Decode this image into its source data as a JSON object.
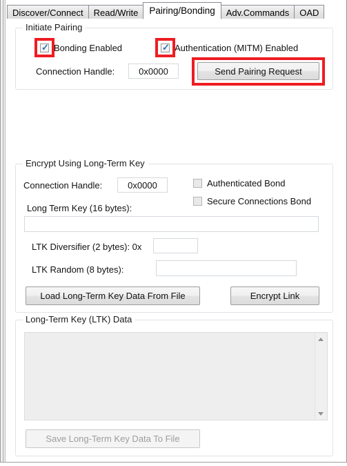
{
  "window": {
    "title": "Pairing/Bonding"
  },
  "tabs": [
    {
      "label": "Discover/Connect",
      "active": false
    },
    {
      "label": "Read/Write",
      "active": false
    },
    {
      "label": "Pairing/Bonding",
      "active": true
    },
    {
      "label": "Adv.Commands",
      "active": false
    },
    {
      "label": "OAD",
      "active": false
    }
  ],
  "initiate_pairing": {
    "title": "Initiate Pairing",
    "bonding_enabled": {
      "label": "Bonding Enabled",
      "checked": true,
      "highlighted": true
    },
    "authentication_mitm": {
      "label": "Authentication (MITM) Enabled",
      "checked": true,
      "highlighted": true
    },
    "connection_handle": {
      "label": "Connection Handle:",
      "value": "0x0000"
    },
    "send_pairing_request": {
      "label": "Send Pairing Request",
      "highlighted": true
    }
  },
  "encrypt_ltk": {
    "title": "Encrypt Using Long-Term Key",
    "connection_handle": {
      "label": "Connection Handle:",
      "value": "0x0000"
    },
    "authenticated_bond": {
      "label": "Authenticated Bond",
      "checked": false
    },
    "secure_connections_bond": {
      "label": "Secure Connections Bond",
      "checked": false
    },
    "long_term_key": {
      "label": "Long Term Key (16 bytes):",
      "value": "",
      "placeholder": ""
    },
    "ltk_diversifier": {
      "label": "LTK Diversifier (2 bytes): 0x",
      "value": "",
      "placeholder": ""
    },
    "ltk_random": {
      "label": "LTK Random (8 bytes):",
      "value": "",
      "placeholder": ""
    },
    "load_button": {
      "label": "Load Long-Term Key Data From File"
    },
    "encrypt_button": {
      "label": "Encrypt Link"
    }
  },
  "ltk_data": {
    "title": "Long-Term Key (LTK) Data",
    "content": "",
    "scrollbar": {
      "up_icon": "triangle-up-icon",
      "down_icon": "triangle-down-icon"
    },
    "save_button": {
      "label": "Save Long-Term Key Data To File",
      "enabled": false
    }
  },
  "colors": {
    "highlight_red": "#ee1d22",
    "checkbox_check": "#2f6fb5",
    "group_border": "#dfe3e8",
    "button_border": "#9c9c9c"
  }
}
